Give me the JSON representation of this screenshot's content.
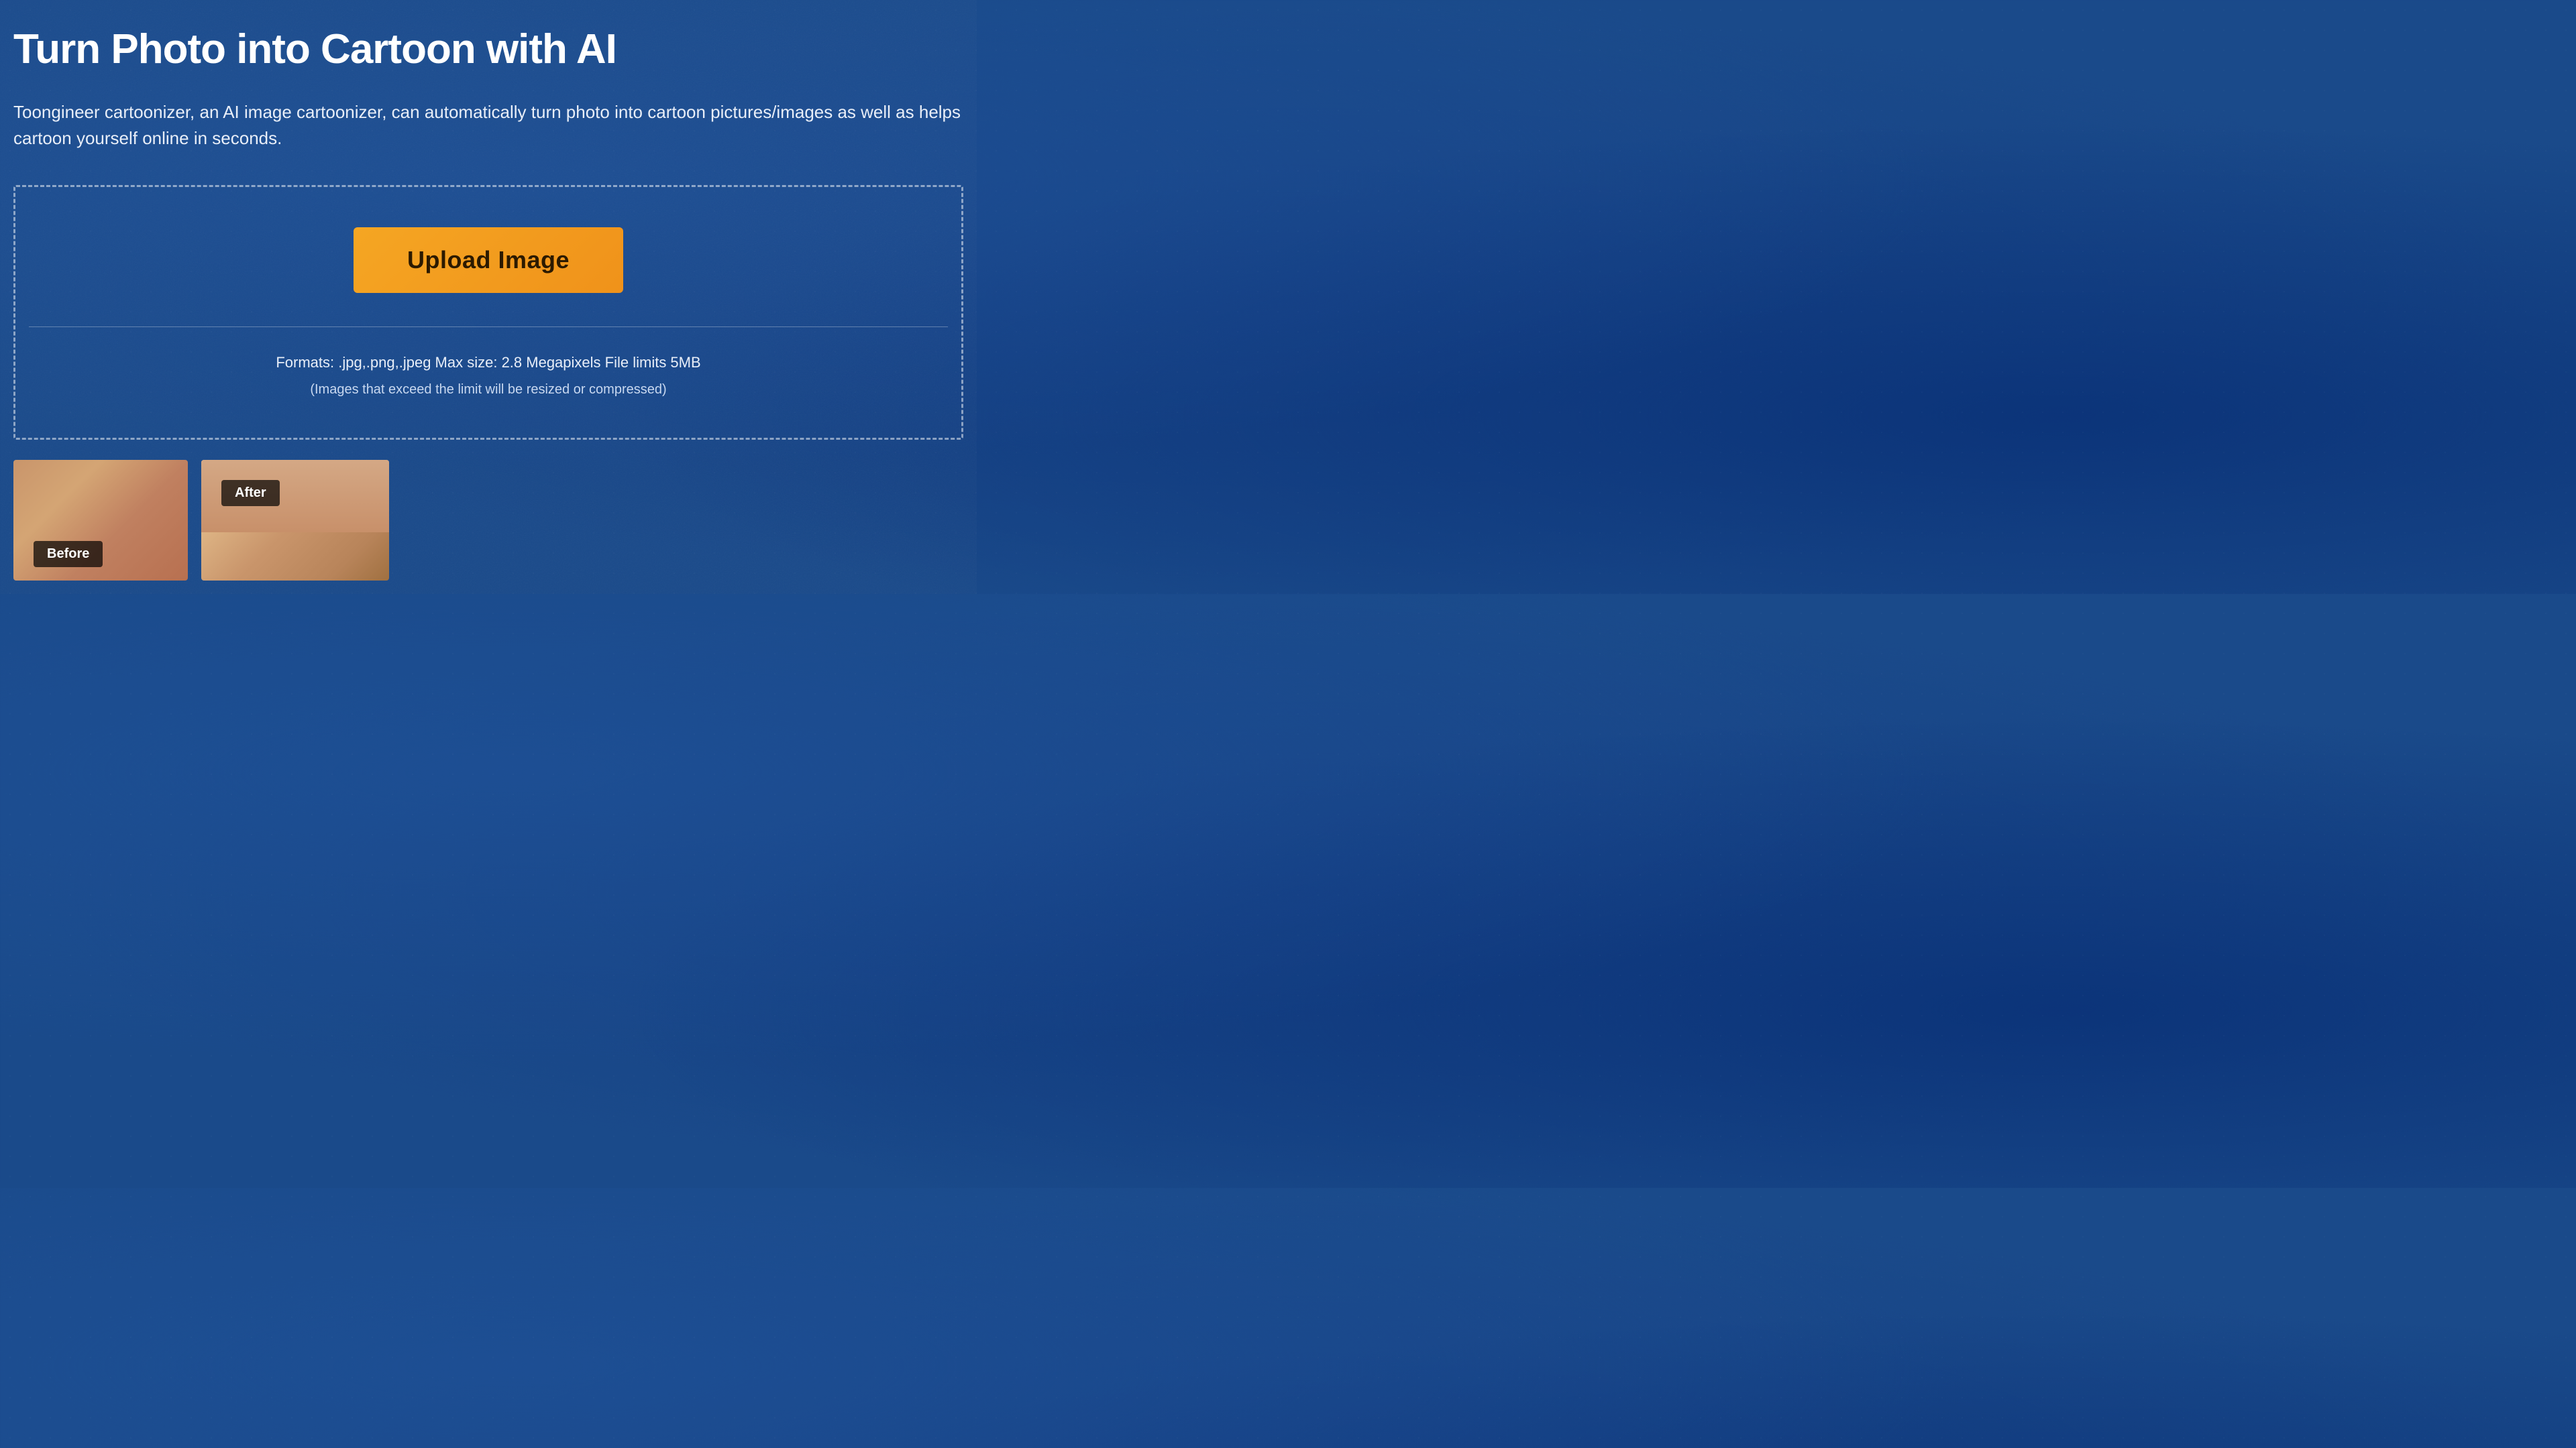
{
  "page": {
    "title": "Turn Photo into Cartoon with AI",
    "description": "Toongineer cartoonizer, an AI image cartoonizer, can automatically turn photo into cartoon pictures/images as well as helps cartoon yourself online in seconds.",
    "background_color": "#1a4a8a"
  },
  "upload_zone": {
    "button_label": "Upload Image",
    "formats_text": "Formats: .jpg,.png,.jpeg Max size: 2.8 Megapixels File limits 5MB",
    "note_text": "(Images that exceed the limit will be resized or compressed)"
  },
  "comparison": {
    "before_label": "Before",
    "after_label": "After"
  }
}
